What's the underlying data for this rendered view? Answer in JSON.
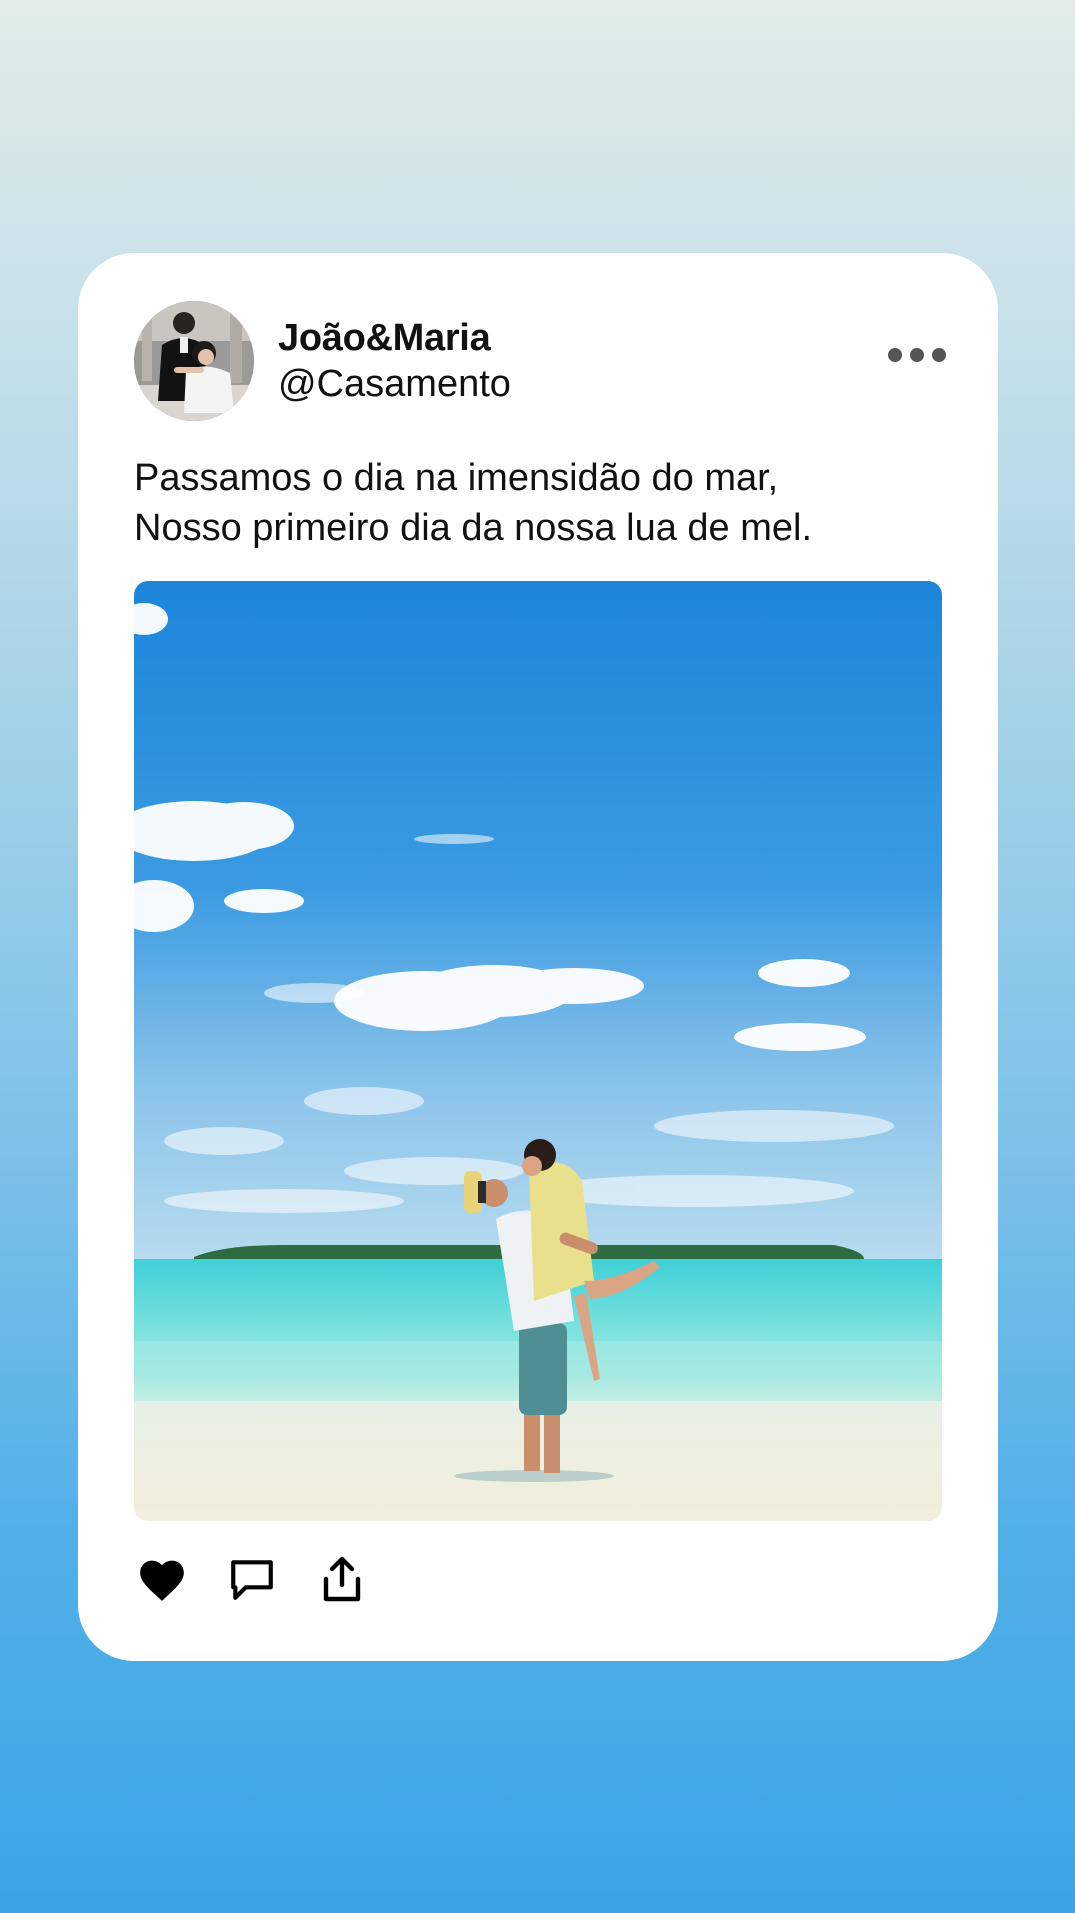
{
  "post": {
    "author_name": "João&Maria",
    "author_handle": "@Casamento",
    "caption_lines": [
      "Passamos o dia na imensidão do mar,",
      "Nosso primeiro dia da nossa lua de mel."
    ],
    "menu_icon": "more-horizontal-icon",
    "actions": [
      {
        "icon": "heart-icon"
      },
      {
        "icon": "comment-icon"
      },
      {
        "icon": "share-icon"
      }
    ]
  },
  "colors": {
    "card_bg": "#ffffff",
    "text": "#111111",
    "menu_dots": "#555555",
    "background_top": "#e2ece8",
    "background_bottom": "#3aa5e6"
  }
}
